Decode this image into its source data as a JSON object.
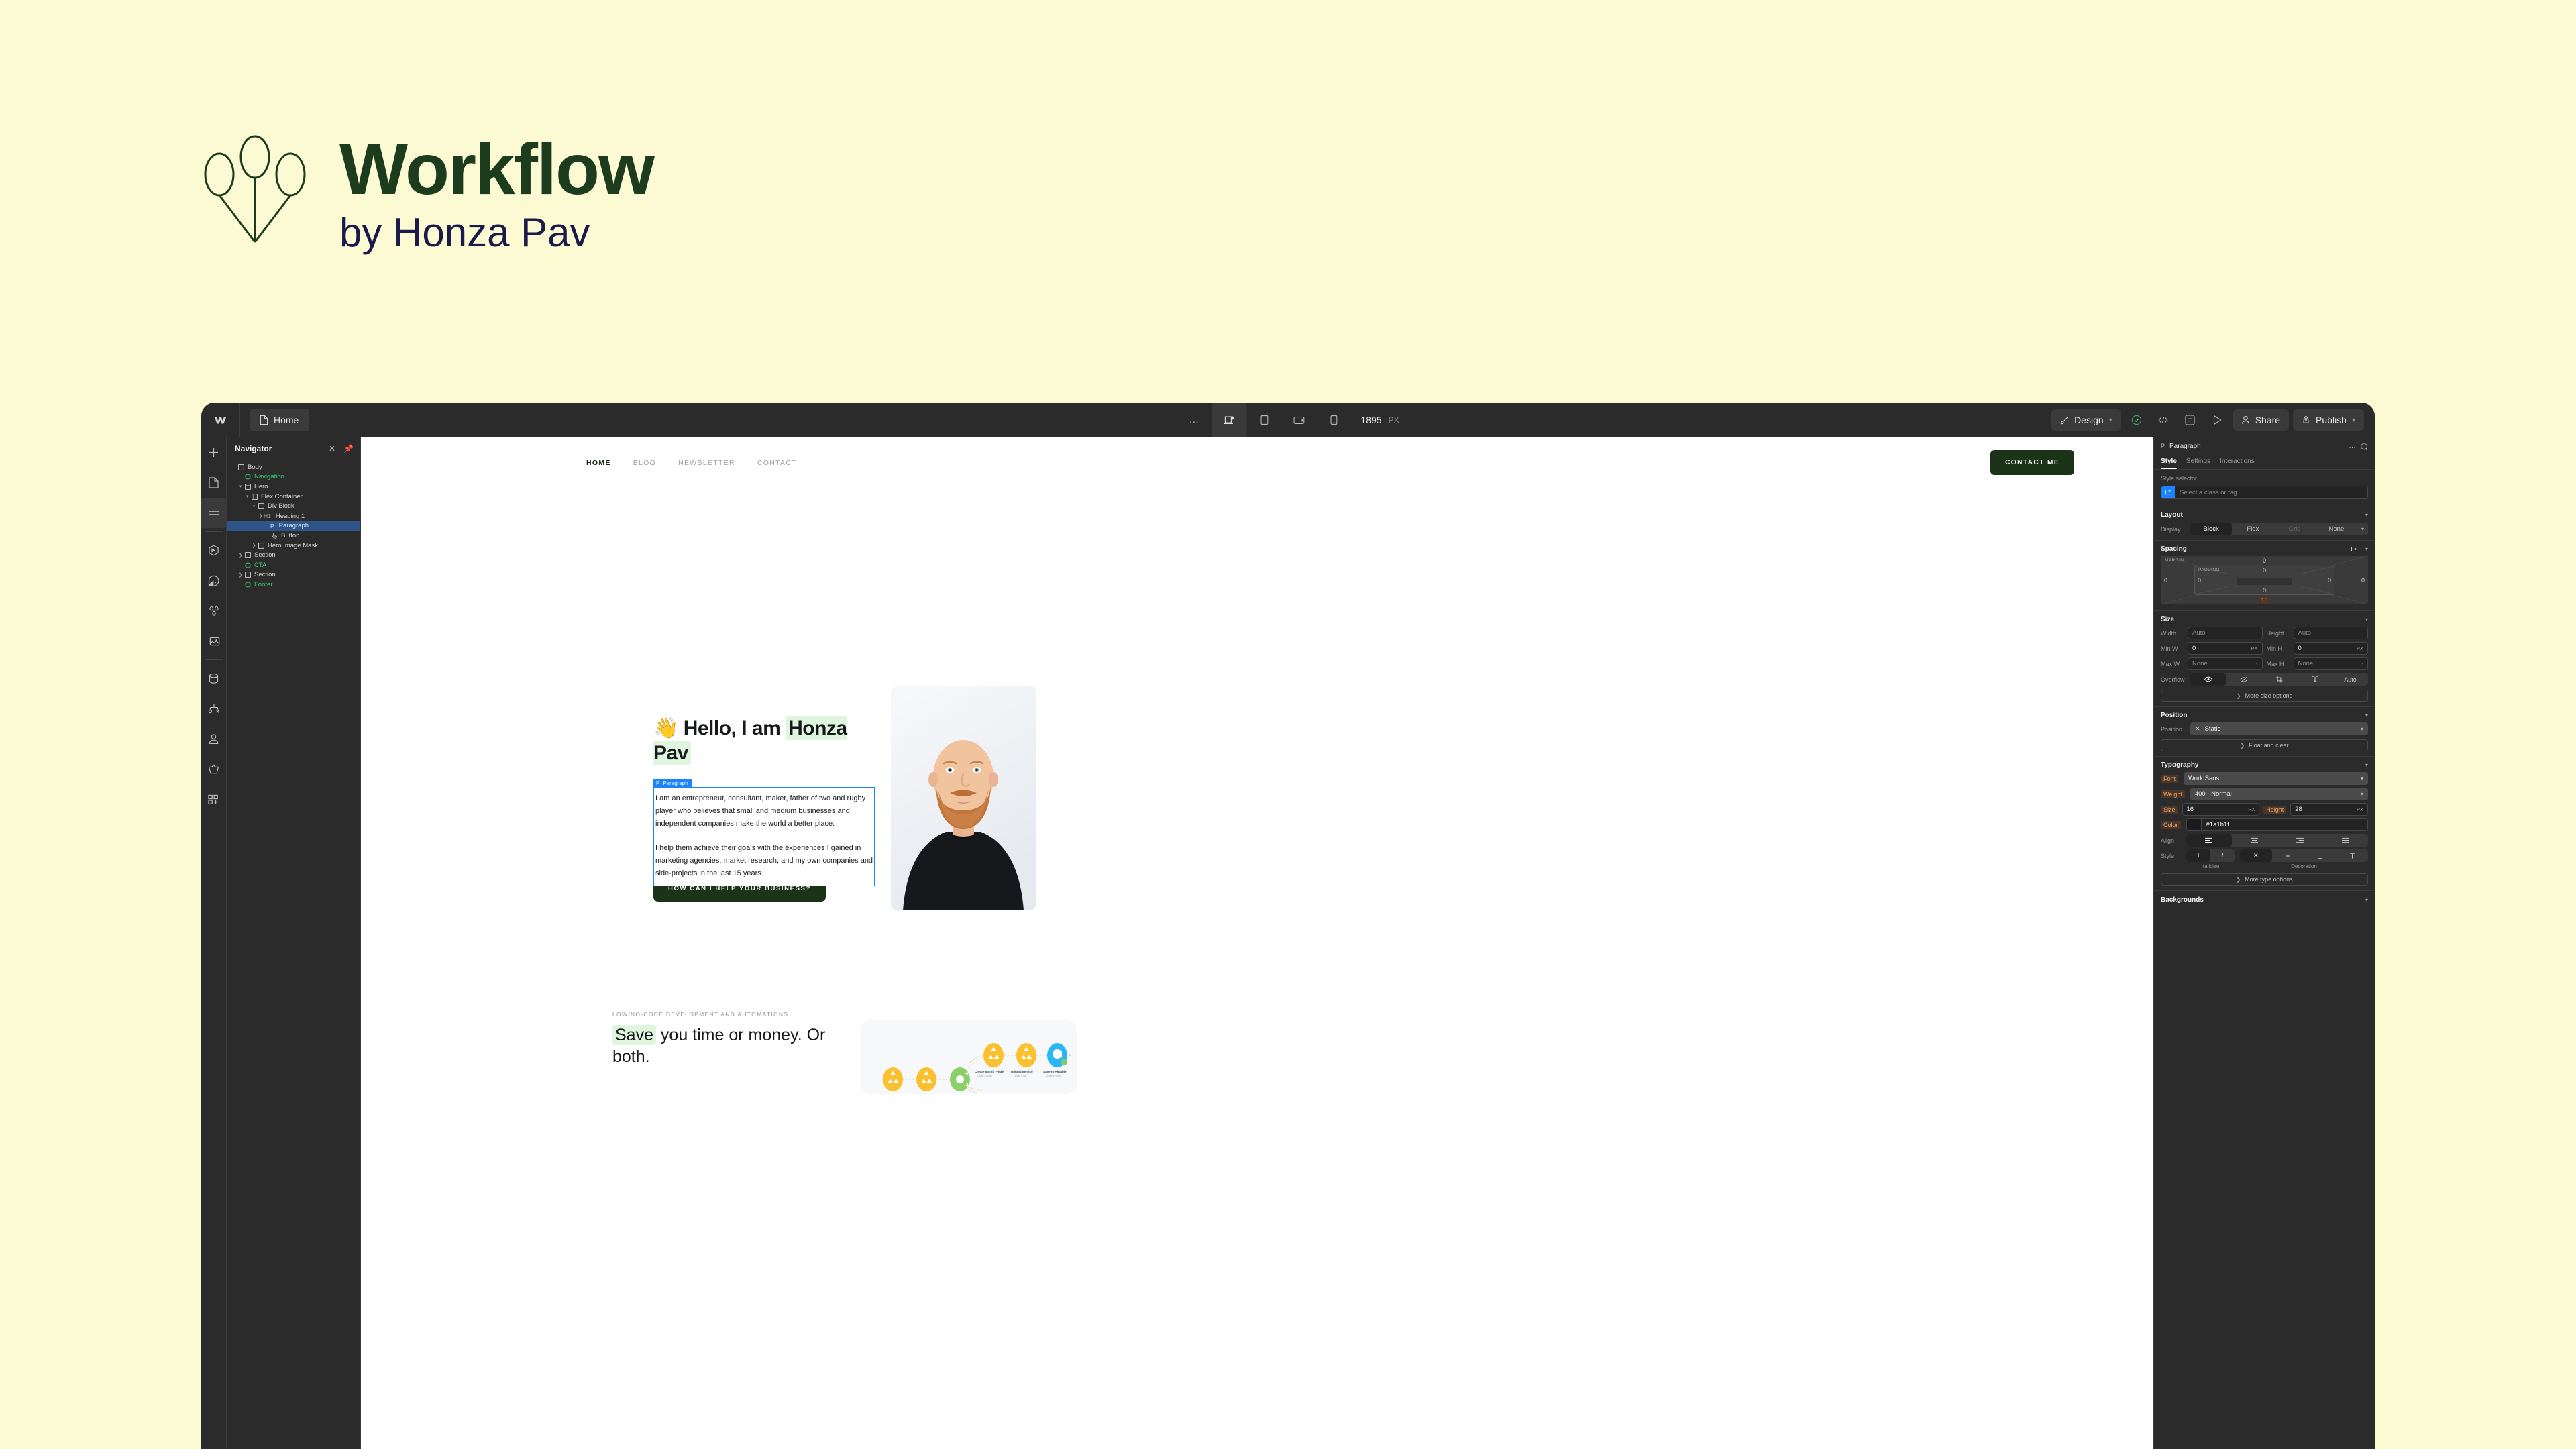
{
  "brand": {
    "title": "Workflow",
    "subtitle": "by Honza Pav",
    "logo_icon": "balloons-logo",
    "title_color": "#1d3b1d",
    "subtitle_color": "#1a1b4b",
    "page_bg": "#fbfad2"
  },
  "topbar": {
    "app_logo_icon": "webflow-logo-icon",
    "page_tab": {
      "label": "Home",
      "icon": "page-doc-icon"
    },
    "center_tools": [
      {
        "name": "more-options-icon",
        "glyph": "…",
        "active": false
      },
      {
        "name": "desktop-breakpoint-icon",
        "active": true
      },
      {
        "name": "tablet-breakpoint-icon",
        "active": false
      },
      {
        "name": "mobile-landscape-breakpoint-icon",
        "active": false
      },
      {
        "name": "mobile-portrait-breakpoint-icon",
        "active": false
      }
    ],
    "viewport_width": "1895",
    "viewport_unit": "PX",
    "mode_label": "Design",
    "right_icons": [
      {
        "name": "checkmark-status-icon"
      },
      {
        "name": "code-export-icon"
      },
      {
        "name": "audit-panel-icon"
      },
      {
        "name": "preview-play-icon"
      }
    ],
    "share_label": "Share",
    "publish_label": "Publish"
  },
  "rail": {
    "items": [
      {
        "name": "add-elements-icon",
        "active": false
      },
      {
        "name": "pages-icon",
        "active": false
      },
      {
        "name": "navigator-icon",
        "active": true
      },
      {
        "name": "components-icon",
        "active": false
      },
      {
        "name": "style-selectors-icon",
        "active": false
      },
      {
        "name": "variables-icon",
        "active": false
      },
      {
        "name": "assets-icon",
        "active": false
      },
      {
        "name": "cms-icon",
        "active": false
      },
      {
        "name": "logic-icon",
        "active": false
      },
      {
        "name": "users-icon",
        "active": false
      },
      {
        "name": "ecommerce-icon",
        "active": false
      },
      {
        "name": "apps-icon",
        "active": false
      }
    ]
  },
  "navigator": {
    "title": "Navigator",
    "close_icon": "close-icon",
    "pin_icon": "pin-icon",
    "tree": [
      {
        "label": "Body",
        "tag": "",
        "indent": 0,
        "icon": "body-icon",
        "arrow": "",
        "green": false,
        "selected": false
      },
      {
        "label": "Navigation",
        "tag": "",
        "indent": 1,
        "icon": "component-icon",
        "arrow": "",
        "green": true,
        "selected": false
      },
      {
        "label": "Hero",
        "tag": "",
        "indent": 1,
        "icon": "section-icon",
        "arrow": "v",
        "green": false,
        "selected": false
      },
      {
        "label": "Flex Container",
        "tag": "",
        "indent": 2,
        "icon": "flex-icon",
        "arrow": "v",
        "green": false,
        "selected": false
      },
      {
        "label": "Div Block",
        "tag": "",
        "indent": 3,
        "icon": "div-icon",
        "arrow": "v",
        "green": false,
        "selected": false
      },
      {
        "label": "Heading 1",
        "tag": "H1",
        "indent": 4,
        "icon": "",
        "arrow": ">",
        "green": false,
        "selected": false
      },
      {
        "label": "Paragraph",
        "tag": "P",
        "indent": 5,
        "icon": "",
        "arrow": "",
        "green": false,
        "selected": true
      },
      {
        "label": "Button",
        "tag": "",
        "indent": 5,
        "icon": "button-icon",
        "arrow": "",
        "green": false,
        "selected": false
      },
      {
        "label": "Hero Image Mask",
        "tag": "",
        "indent": 3,
        "icon": "div-icon",
        "arrow": ">",
        "green": false,
        "selected": false
      },
      {
        "label": "Section",
        "tag": "",
        "indent": 1,
        "icon": "div-icon",
        "arrow": ">",
        "green": false,
        "selected": false
      },
      {
        "label": "CTA",
        "tag": "",
        "indent": 1,
        "icon": "component-icon",
        "arrow": "",
        "green": true,
        "selected": false
      },
      {
        "label": "Section",
        "tag": "",
        "indent": 1,
        "icon": "div-icon",
        "arrow": ">",
        "green": false,
        "selected": false
      },
      {
        "label": "Footer",
        "tag": "",
        "indent": 1,
        "icon": "component-icon",
        "arrow": "",
        "green": true,
        "selected": false
      }
    ]
  },
  "canvas": {
    "site_nav": {
      "links": [
        {
          "label": "HOME",
          "current": true
        },
        {
          "label": "BLOG",
          "current": false
        },
        {
          "label": "NEWSLETTER",
          "current": false
        },
        {
          "label": "CONTACT",
          "current": false
        }
      ],
      "cta_label": "CONTACT ME"
    },
    "hero": {
      "wave_emoji": "👋",
      "heading_plain": "Hello, I am ",
      "heading_highlight": "Honza Pav",
      "selection_badge": {
        "tag": "P",
        "label": "Paragraph"
      },
      "paragraphs": [
        "I am an entrepreneur, consultant, maker, father of two and rugby player who believes that small and medium businesses and independent companies make the world a better place.",
        "I help them achieve their goals with the experiences I gained in marketing agencies, market research, and my own companies and side-projects in the last 15 years."
      ],
      "cta_label": "HOW CAN I HELP YOUR BUSINESS?",
      "portrait_alt": "portrait-photo"
    },
    "section_two": {
      "eyebrow": "LOW/NO-CODE DEVELOPMENT AND AUTOMATIONS",
      "heading_highlight": "Save",
      "heading_rest": " you time or money. Or both.",
      "diagram_alt": "automation-scenario-diagram"
    }
  },
  "inspector": {
    "element_tag": "P",
    "element_name": "Paragraph",
    "more_icon": "more-options-icon",
    "add-component_icon": "create-component-icon",
    "tabs": [
      {
        "label": "Style",
        "active": true
      },
      {
        "label": "Settings",
        "active": false
      },
      {
        "label": "Interactions",
        "active": false
      }
    ],
    "style_selector": {
      "label": "Style selector",
      "placeholder": "Select a class or tag",
      "indicator_icon": "element-tag-icon",
      "indicator_color": "#1a84ff"
    },
    "layout": {
      "title": "Layout",
      "display_label": "Display",
      "display_options": [
        {
          "label": "Block",
          "active": true,
          "disabled": false
        },
        {
          "label": "Flex",
          "active": false,
          "disabled": false
        },
        {
          "label": "Grid",
          "active": false,
          "disabled": true
        },
        {
          "label": "None",
          "active": false,
          "disabled": false
        }
      ]
    },
    "spacing": {
      "title": "Spacing",
      "margin_label": "MARGIN",
      "padding_label": "PADDING",
      "margin": {
        "top": "0",
        "right": "0",
        "bottom": "10",
        "left": "0"
      },
      "padding": {
        "top": "0",
        "right": "0",
        "bottom": "0",
        "left": "0"
      },
      "highlight_color": "#d58b4a",
      "link_icon": "spacing-link-icon"
    },
    "size": {
      "title": "Size",
      "rows": [
        {
          "l1": "Width",
          "v1": "Auto",
          "u1": "-",
          "l2": "Height",
          "v2": "Auto",
          "u2": "-"
        },
        {
          "l1": "Min W",
          "v1": "0",
          "u1": "PX",
          "l2": "Min H",
          "v2": "0",
          "u2": "PX"
        },
        {
          "l1": "Max W",
          "v1": "None",
          "u1": "-",
          "l2": "Max H",
          "v2": "None",
          "u2": "-"
        }
      ],
      "overflow_label": "Overflow",
      "overflow_options": [
        {
          "name": "overflow-visible-icon",
          "active": true
        },
        {
          "name": "overflow-hidden-icon",
          "active": false
        },
        {
          "name": "overflow-scroll-icon",
          "active": false
        },
        {
          "name": "overflow-clip-icon",
          "active": false
        },
        {
          "name": "overflow-auto-label",
          "active": false,
          "label": "Auto"
        }
      ],
      "more_label": "More size options"
    },
    "position": {
      "title": "Position",
      "label": "Position",
      "value": "Static",
      "clear_icon": "clear-x-icon",
      "float_label": "Float and clear"
    },
    "typography": {
      "title": "Typography",
      "font_label": "Font",
      "font_value": "Work Sans",
      "weight_label": "Weight",
      "weight_value": "400 - Normal",
      "size_label": "Size",
      "size_value": "16",
      "size_unit": "PX",
      "height_label": "Height",
      "height_value": "28",
      "height_unit": "PX",
      "color_label": "Color",
      "color_value": "#1a1b1f",
      "align_label": "Align",
      "align_options": [
        {
          "name": "align-left-icon",
          "active": true
        },
        {
          "name": "align-center-icon",
          "active": false
        },
        {
          "name": "align-right-icon",
          "active": false
        },
        {
          "name": "align-justify-icon",
          "active": false
        }
      ],
      "style_label": "Style",
      "italic_options": [
        {
          "name": "upright-icon",
          "active": true
        },
        {
          "name": "italic-icon",
          "active": false
        }
      ],
      "decoration_options": [
        {
          "name": "decoration-none-icon",
          "active": true
        },
        {
          "name": "decoration-strikethrough-icon",
          "active": false
        },
        {
          "name": "decoration-underline-icon",
          "active": false
        },
        {
          "name": "decoration-overline-icon",
          "active": false
        }
      ],
      "italicize_caption": "Italicize",
      "decoration_caption": "Decoration",
      "more_label": "More type options",
      "modified_color": "#e08a4c"
    },
    "backgrounds": {
      "title": "Backgrounds"
    }
  }
}
